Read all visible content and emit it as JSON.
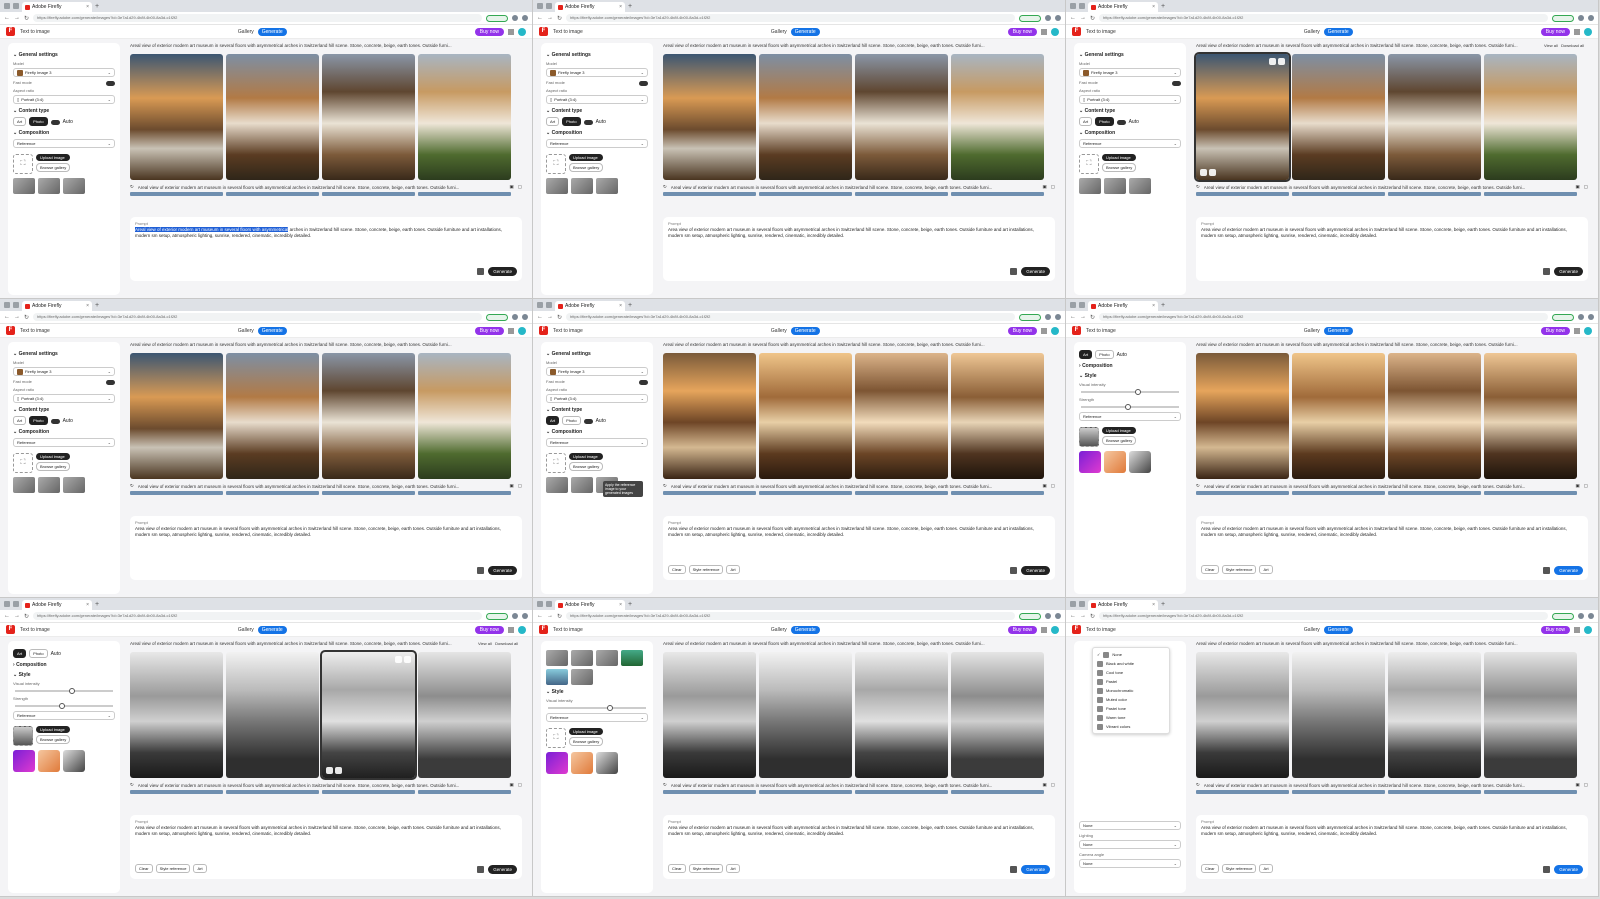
{
  "browser": {
    "tab_title": "Adobe Firefly",
    "tab_close": "×",
    "new_tab": "+",
    "url": "https://firefly.adobe.com/generate/images?id=3e7a1d29-4b8f-4b00-8a3d-c1f2f2",
    "nav_back": "←",
    "nav_forward": "→",
    "nav_reload": "↻"
  },
  "app": {
    "back_label": "Text to image",
    "gallery_label": "Gallery",
    "generate_tab_label": "Generate",
    "buy_label": "Buy now"
  },
  "panel": {
    "general_settings": "General settings",
    "model_label": "Model",
    "model_value": "Firefly Image 3",
    "fast_mode_label": "Fast mode",
    "aspect_label": "Aspect ratio",
    "aspect_value": "Portrait (3:4)",
    "content_type": "Content type",
    "art": "Art",
    "photo": "Photo",
    "auto": "Auto",
    "composition": "Composition",
    "reference": "Reference",
    "upload_image": "Upload image",
    "browse_gallery": "Browse gallery",
    "style": "Style",
    "visual_intensity": "Visual intensity",
    "strength": "Strength",
    "effects_none": "None",
    "lighting": "Lighting",
    "camera_angle": "Camera angle"
  },
  "prompt": {
    "title": "Areal view of exterior modern art museum in several floors with asymmetrical arches in Switzerland hill scene. Stone, concrete, beige, earth tones. Outside furni...",
    "label": "Prompt",
    "selected": "Areal view of exterior modern art museum in several floors with asymmetrical",
    "rest": "arches in Switzerland hill scene. Stone, concrete, beige, earth tones. Outside furniture and art installations, modern sm setup, atmospheric lighting, sunrise, rendered, cinematic, incredibly detailed.",
    "full": "Area view of exterior modern art museum in several floors with asymmetrical arches in Switzerland hill scene. Stone, concrete, beige, earth tones. Outside furniture and art installations, modern sm setup, atmospheric lighting, sunrise, rendered, cinematic, incredibly detailed.",
    "generate": "Generate",
    "chip_clear": "Clear",
    "chip_style": "Style reference",
    "chip_art": "Art"
  },
  "image_tools": {
    "view_all": "View all",
    "download_all": "Download all"
  },
  "tooltip": "Apply the reference image to your generated images",
  "effects_menu": [
    "None",
    "Black and white",
    "Cool tone",
    "Pastel",
    "Monochromatic",
    "Muted color",
    "Pastel tone",
    "Warm tone",
    "Vibrant colors"
  ]
}
